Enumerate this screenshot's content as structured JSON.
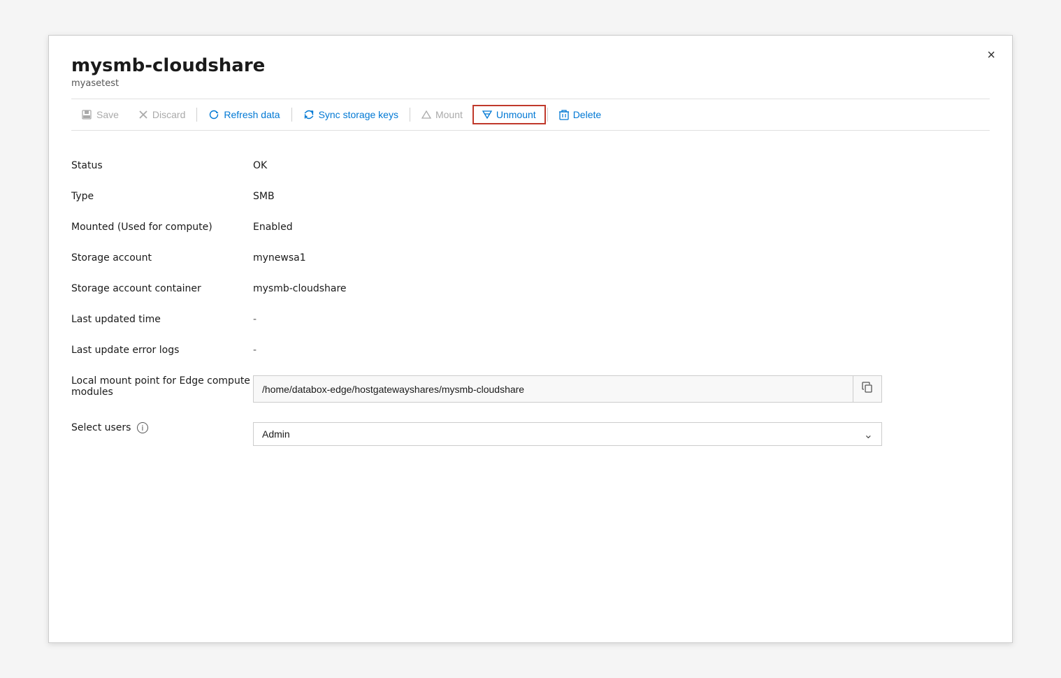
{
  "panel": {
    "title": "mysmb-cloudshare",
    "subtitle": "myasetest"
  },
  "toolbar": {
    "save_label": "Save",
    "discard_label": "Discard",
    "refresh_label": "Refresh data",
    "sync_label": "Sync storage keys",
    "mount_label": "Mount",
    "unmount_label": "Unmount",
    "delete_label": "Delete"
  },
  "fields": [
    {
      "label": "Status",
      "value": "OK",
      "type": "text"
    },
    {
      "label": "Type",
      "value": "SMB",
      "type": "text"
    },
    {
      "label": "Mounted (Used for compute)",
      "value": "Enabled",
      "type": "text"
    },
    {
      "label": "Storage account",
      "value": "mynewsa1",
      "type": "text"
    },
    {
      "label": "Storage account container",
      "value": "mysmb-cloudshare",
      "type": "text"
    },
    {
      "label": "Last updated time",
      "value": "-",
      "type": "text"
    },
    {
      "label": "Last update error logs",
      "value": "-",
      "type": "text"
    },
    {
      "label": "Local mount point for Edge compute modules",
      "value": "/home/databox-edge/hostgatewayshares/mysmb-cloudshare",
      "type": "path"
    },
    {
      "label": "Select users",
      "value": "Admin",
      "type": "select"
    }
  ],
  "close_label": "×",
  "colors": {
    "accent": "#0078d4",
    "unmount_border": "#c0392b",
    "disabled": "#aaaaaa"
  }
}
